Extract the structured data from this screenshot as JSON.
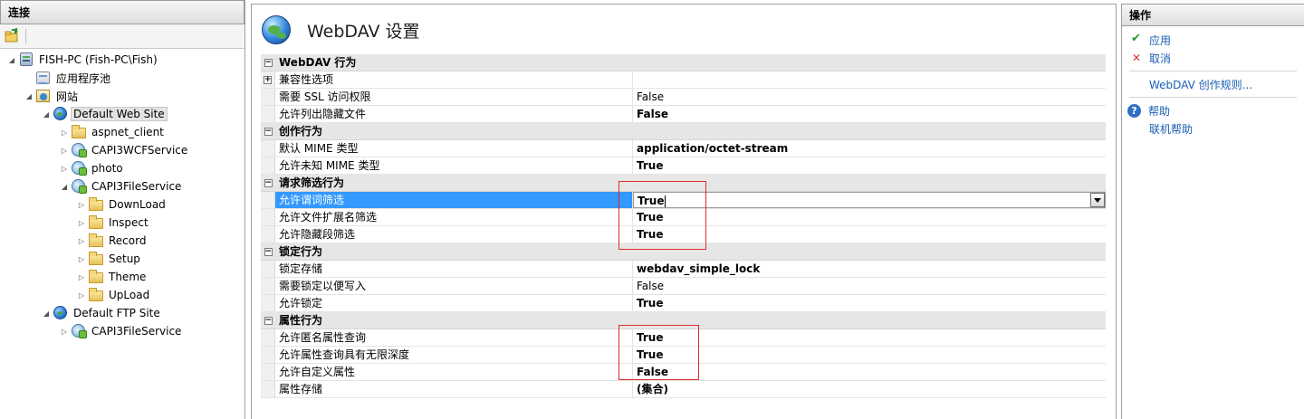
{
  "connections": {
    "title": "连接",
    "tree": [
      {
        "label": "FISH-PC (Fish-PC\\Fish)",
        "icon": "server-icon",
        "expanded": true
      },
      {
        "label": "应用程序池",
        "icon": "app-pool-icon"
      },
      {
        "label": "网站",
        "icon": "sites-icon",
        "expanded": true
      },
      {
        "label": "Default Web Site",
        "icon": "globe-icon",
        "expanded": true,
        "selected": true
      },
      {
        "label": "aspnet_client",
        "icon": "folder-icon"
      },
      {
        "label": "CAPI3WCFService",
        "icon": "application-icon"
      },
      {
        "label": "photo",
        "icon": "application-icon"
      },
      {
        "label": "CAPI3FileService",
        "icon": "application-icon",
        "expanded": true
      },
      {
        "label": "DownLoad",
        "icon": "folder-icon"
      },
      {
        "label": "Inspect",
        "icon": "folder-icon"
      },
      {
        "label": "Record",
        "icon": "folder-icon"
      },
      {
        "label": "Setup",
        "icon": "folder-icon"
      },
      {
        "label": "Theme",
        "icon": "folder-icon"
      },
      {
        "label": "UpLoad",
        "icon": "folder-icon"
      },
      {
        "label": "Default FTP Site",
        "icon": "globe-icon",
        "expanded": true
      },
      {
        "label": "CAPI3FileService",
        "icon": "application-icon"
      }
    ]
  },
  "page": {
    "title": "WebDAV 设置"
  },
  "settings": {
    "webdav_behavior": {
      "title": "WebDAV 行为",
      "compat": "兼容性选项",
      "ssl_label": "需要 SSL 访问权限",
      "ssl_value": "False",
      "hidden_label": "允许列出隐藏文件",
      "hidden_value": "False"
    },
    "authoring": {
      "title": "创作行为",
      "mime_label": "默认 MIME 类型",
      "mime_value": "application/octet-stream",
      "unknown_label": "允许未知 MIME 类型",
      "unknown_value": "True"
    },
    "filtering": {
      "title": "请求筛选行为",
      "verb_label": "允许谓词筛选",
      "verb_value": "True",
      "ext_label": "允许文件扩展名筛选",
      "ext_value": "True",
      "segment_label": "允许隐藏段筛选",
      "segment_value": "True"
    },
    "locking": {
      "title": "锁定行为",
      "store_label": "锁定存储",
      "store_value": "webdav_simple_lock",
      "required_label": "需要锁定以便写入",
      "required_value": "False",
      "allow_label": "允许锁定",
      "allow_value": "True"
    },
    "properties": {
      "title": "属性行为",
      "anon_label": "允许匿名属性查询",
      "anon_value": "True",
      "infinite_label": "允许属性查询具有无限深度",
      "infinite_value": "True",
      "custom_label": "允许自定义属性",
      "custom_value": "False",
      "store_label": "属性存储",
      "store_value": "(集合)"
    }
  },
  "actions": {
    "title": "操作",
    "apply": "应用",
    "cancel": "取消",
    "authoring_rules": "WebDAV 创作规则...",
    "help": "帮助",
    "online_help": "联机帮助"
  },
  "colors": {
    "selection": "#3399ff",
    "link": "#1a5fb4",
    "highlight_box": "#e02b2b"
  }
}
